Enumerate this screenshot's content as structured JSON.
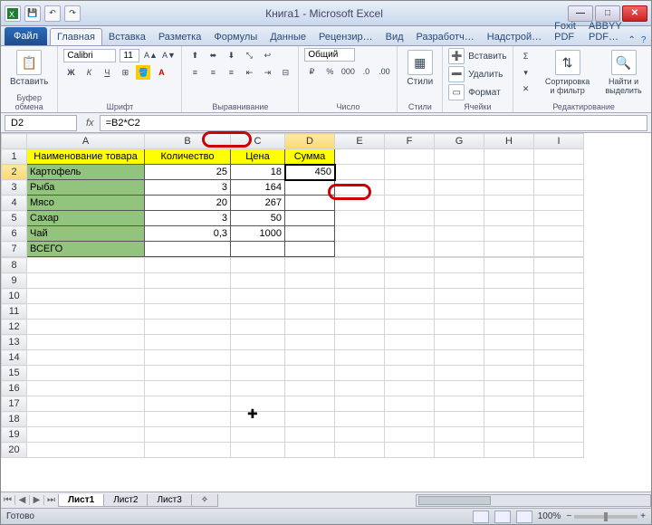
{
  "title": "Книга1 - Microsoft Excel",
  "tabs": {
    "file": "Файл",
    "list": [
      "Главная",
      "Вставка",
      "Разметка",
      "Формулы",
      "Данные",
      "Рецензир…",
      "Вид",
      "Разработч…",
      "Надстрой…",
      "Foxit PDF",
      "ABBYY PDF…"
    ],
    "active": 0
  },
  "ribbon": {
    "clipboard": {
      "label": "Буфер обмена",
      "paste": "Вставить"
    },
    "font": {
      "label": "Шрифт",
      "family": "Calibri",
      "size": "11"
    },
    "align": {
      "label": "Выравнивание"
    },
    "number": {
      "label": "Число",
      "format": "Общий"
    },
    "styles": {
      "label": "Стили",
      "btn": "Стили"
    },
    "cells": {
      "label": "Ячейки",
      "insert": "Вставить",
      "delete": "Удалить",
      "format": "Формат"
    },
    "editing": {
      "label": "Редактирование",
      "sort": "Сортировка и фильтр",
      "find": "Найти и выделить"
    }
  },
  "formula_bar": {
    "name_box": "D2",
    "fx": "fx",
    "formula": "=B2*C2"
  },
  "columns": [
    "A",
    "B",
    "C",
    "D",
    "E",
    "F",
    "G",
    "H",
    "I"
  ],
  "headers": {
    "A": "Наименование товара",
    "B": "Количество",
    "C": "Цена",
    "D": "Сумма"
  },
  "rows": [
    {
      "r": 2,
      "A": "Картофель",
      "B": "25",
      "C": "18",
      "D": "450"
    },
    {
      "r": 3,
      "A": "Рыба",
      "B": "3",
      "C": "164",
      "D": ""
    },
    {
      "r": 4,
      "A": "Мясо",
      "B": "20",
      "C": "267",
      "D": ""
    },
    {
      "r": 5,
      "A": "Сахар",
      "B": "3",
      "C": "50",
      "D": ""
    },
    {
      "r": 6,
      "A": "Чай",
      "B": "0,3",
      "C": "1000",
      "D": ""
    },
    {
      "r": 7,
      "A": "ВСЕГО",
      "B": "",
      "C": "",
      "D": ""
    }
  ],
  "sheets": {
    "list": [
      "Лист1",
      "Лист2",
      "Лист3"
    ],
    "active": 0
  },
  "status": {
    "ready": "Готово",
    "zoom": "100%"
  }
}
